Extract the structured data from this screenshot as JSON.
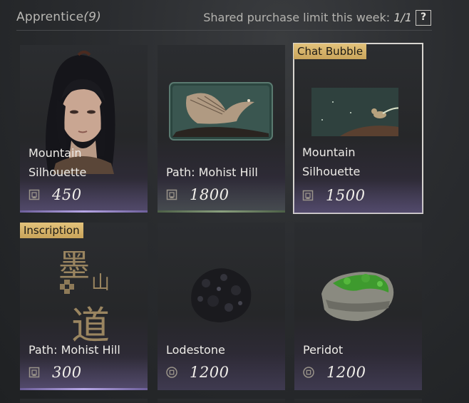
{
  "header": {
    "title": "Apprentice",
    "count": "(9)",
    "limit_label": "Shared purchase limit this week: ",
    "limit_value": "1/1",
    "help": "?"
  },
  "items": [
    {
      "name_line1": "Mountain",
      "name_line2": "Silhouette",
      "price": "450",
      "tag": "",
      "currency": "token-icon"
    },
    {
      "name_line1": "Path: Mohist Hill",
      "name_line2": "",
      "price": "1800",
      "tag": "",
      "currency": "token-icon"
    },
    {
      "name_line1": "Mountain",
      "name_line2": "Silhouette",
      "price": "1500",
      "tag": "Chat Bubble",
      "currency": "token-icon"
    },
    {
      "name_line1": "Path: Mohist Hill",
      "name_line2": "",
      "price": "300",
      "tag": "Inscription",
      "currency": "token-icon"
    },
    {
      "name_line1": "Lodestone",
      "name_line2": "",
      "price": "1200",
      "tag": "",
      "currency": "coin-icon"
    },
    {
      "name_line1": "Peridot",
      "name_line2": "",
      "price": "1200",
      "tag": "",
      "currency": "coin-icon"
    }
  ],
  "inscription_glyphs": [
    "墨",
    "山",
    "道"
  ]
}
